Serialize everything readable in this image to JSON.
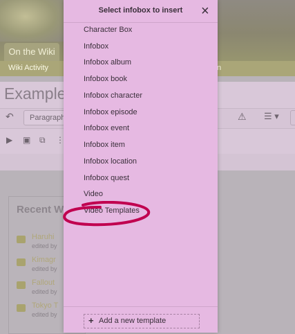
{
  "background": {
    "tab": "On the Wiki",
    "nav_item": "Wiki Activity",
    "nav_right_fragment": "n",
    "page_title": "Example",
    "paragraph_select": "Paragraph",
    "recent_title": "Recent Wiki",
    "recent_items": [
      {
        "link": "Haruhi",
        "byline": "edited by"
      },
      {
        "link": "Kimagr",
        "byline": "edited by"
      },
      {
        "link": "Fallout",
        "byline": "edited by"
      },
      {
        "link": "Tokyo T",
        "byline": "edited by"
      }
    ]
  },
  "modal": {
    "title": "Select infobox to insert",
    "close_glyph": "×",
    "options": [
      "Character Box",
      "Infobox",
      "Infobox album",
      "Infobox book",
      "Infobox character",
      "Infobox episode",
      "Infobox event",
      "Infobox item",
      "Infobox location",
      "Infobox quest",
      "Video",
      "Video Templates"
    ],
    "add_label": "Add a new template",
    "add_glyph": "+"
  },
  "colors": {
    "modal_bg": "#e6b9e2",
    "annotation": "#c0004f",
    "overlay": "#b9b3b9"
  },
  "icons": {
    "undo": "undo-icon",
    "warning": "warning-icon",
    "menu": "menu-icon",
    "close": "close-icon",
    "plus": "plus-icon"
  }
}
